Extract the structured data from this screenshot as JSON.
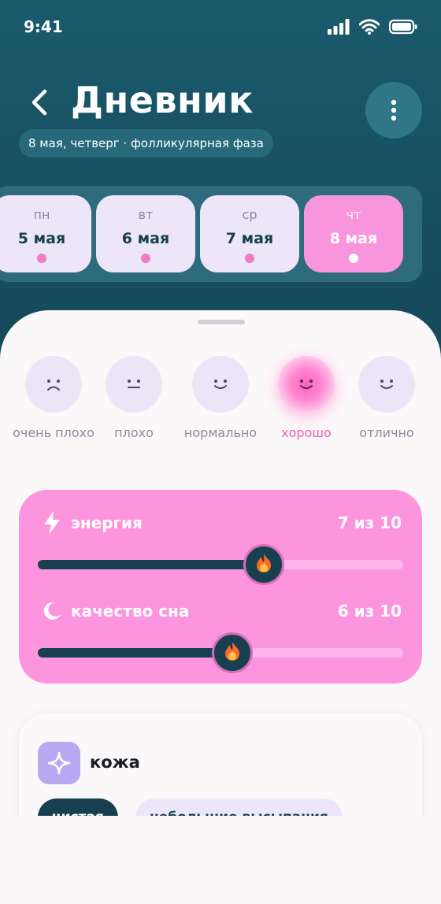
{
  "status_bar": {
    "time": "9:41"
  },
  "header": {
    "title": "Дневник",
    "subtitle": "8 мая, четверг · фолликулярная фаза"
  },
  "days": [
    {
      "dow": "пн",
      "date": "5 мая",
      "active": false
    },
    {
      "dow": "вт",
      "date": "6 мая",
      "active": false
    },
    {
      "dow": "ср",
      "date": "7 мая",
      "active": false
    },
    {
      "dow": "чт",
      "date": "8 мая",
      "active": true
    }
  ],
  "moods": [
    {
      "label": "очень плохо",
      "face": "very-sad"
    },
    {
      "label": "плохо",
      "face": "neutral"
    },
    {
      "label": "нормально",
      "face": "smile"
    },
    {
      "label": "хорошо",
      "face": "smile",
      "selected": true
    },
    {
      "label": "отлично",
      "face": "smile"
    }
  ],
  "metrics": {
    "energy": {
      "label": "энергия",
      "value_text": "7 из 10",
      "value": 7,
      "max": 10,
      "icon": "lightning-icon",
      "thumb_icon": "fire-icon"
    },
    "sleep": {
      "label": "качество сна",
      "value_text": "6 из 10",
      "value": 6,
      "max": 10,
      "icon": "moon-icon",
      "thumb_icon": "fire-icon"
    }
  },
  "skin": {
    "title": "кожа",
    "icon": "sparkle-icon",
    "options": [
      {
        "label": "чистая",
        "selected": true
      },
      {
        "label": "небольшие высыпания",
        "selected": false
      }
    ]
  },
  "colors": {
    "header_bg": "#14485a",
    "accent_pink": "#fd95de",
    "accent_dark": "#173f4f",
    "mood_selected_text": "#f05bb8",
    "chip_bg": "#ece6f8"
  }
}
